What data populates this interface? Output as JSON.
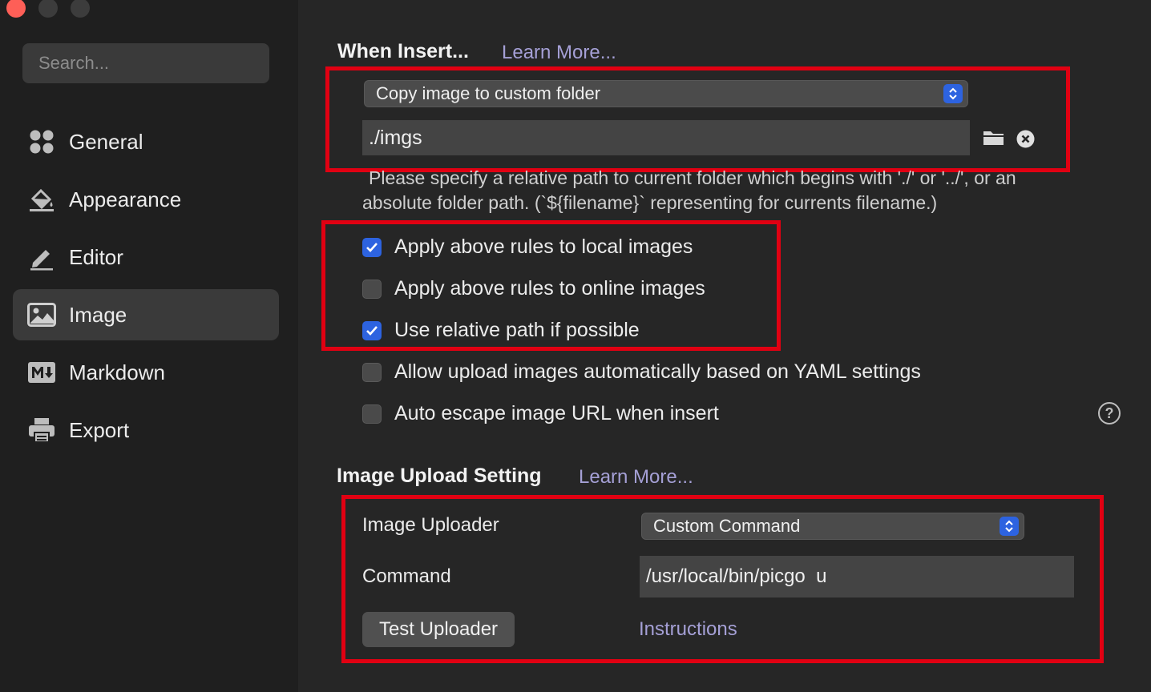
{
  "sidebar": {
    "search_placeholder": "Search...",
    "items": [
      {
        "label": "General",
        "icon": "general-icon"
      },
      {
        "label": "Appearance",
        "icon": "paint-bucket-icon"
      },
      {
        "label": "Editor",
        "icon": "pencil-icon"
      },
      {
        "label": "Image",
        "icon": "image-icon",
        "active": true
      },
      {
        "label": "Markdown",
        "icon": "markdown-icon"
      },
      {
        "label": "Export",
        "icon": "printer-icon"
      }
    ]
  },
  "insert": {
    "title": "When Insert...",
    "learn_more": "Learn More...",
    "action_select": "Copy image to custom folder",
    "folder_value": "./imgs",
    "hint_line1": "Please specify a relative path to current folder which begins with './' or '../', or an",
    "hint_line2": "absolute folder path. (`${filename}` representing for currents filename.)",
    "options": [
      {
        "label": "Apply above rules to local images",
        "checked": true
      },
      {
        "label": "Apply above rules to online images",
        "checked": false
      },
      {
        "label": "Use relative path if possible",
        "checked": true
      },
      {
        "label": "Allow upload images automatically based on YAML settings",
        "checked": false
      },
      {
        "label": "Auto escape image URL when insert",
        "checked": false
      }
    ]
  },
  "upload": {
    "title": "Image Upload Setting",
    "learn_more": "Learn More...",
    "uploader_label": "Image Uploader",
    "uploader_value": "Custom Command",
    "command_label": "Command",
    "command_value": "/usr/local/bin/picgo  u",
    "test_button": "Test Uploader",
    "instructions": "Instructions"
  },
  "colors": {
    "accent": "#2d63e0",
    "highlight_box": "#e10012",
    "link": "#a5a0d6"
  }
}
